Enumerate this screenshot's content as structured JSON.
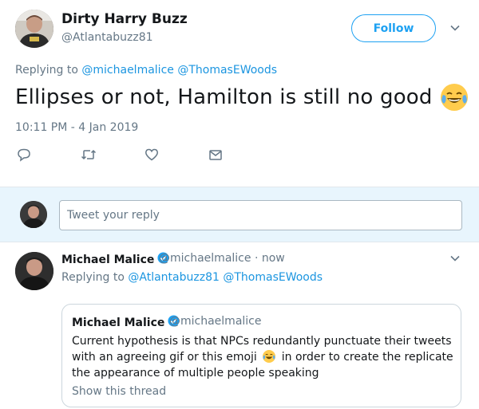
{
  "main_tweet": {
    "author_name": "Dirty Harry Buzz",
    "author_handle": "@Atlantabuzz81",
    "follow_label": "Follow",
    "replying_prefix": "Replying to",
    "replying_mentions": [
      "@michaelmalice",
      "@ThomasEWoods"
    ],
    "text": "Ellipses or not, Hamilton is still no good",
    "emoji": "face-with-tears-of-joy",
    "timestamp": "10:11 PM - 4 Jan 2019"
  },
  "actions": [
    "reply-icon",
    "retweet-icon",
    "like-icon",
    "direct-message-icon"
  ],
  "reply_box": {
    "placeholder": "Tweet your reply"
  },
  "reply_tweet": {
    "author_name": "Michael Malice",
    "author_handle": "@michaelmalice",
    "time": "· now",
    "replying_prefix": "Replying to",
    "replying_mentions": [
      "@Atlantabuzz81",
      "@ThomasEWoods"
    ],
    "quote": {
      "author_name": "Michael Malice",
      "author_handle": "@michaelmalice",
      "text_before_emoji": "Current hypothesis is that NPCs redundantly punctuate their tweets with an agreeing gif or this emoji",
      "text_after_emoji": "in order to create the replicate the appearance of multiple people speaking",
      "show_thread": "Show this thread"
    }
  },
  "colors": {
    "accent": "#1da1f2",
    "mention": "#1b95e0",
    "secondary_text": "#657786",
    "reply_bg": "#e8f5fd",
    "emoji_yellow": "#ffcc4d"
  }
}
